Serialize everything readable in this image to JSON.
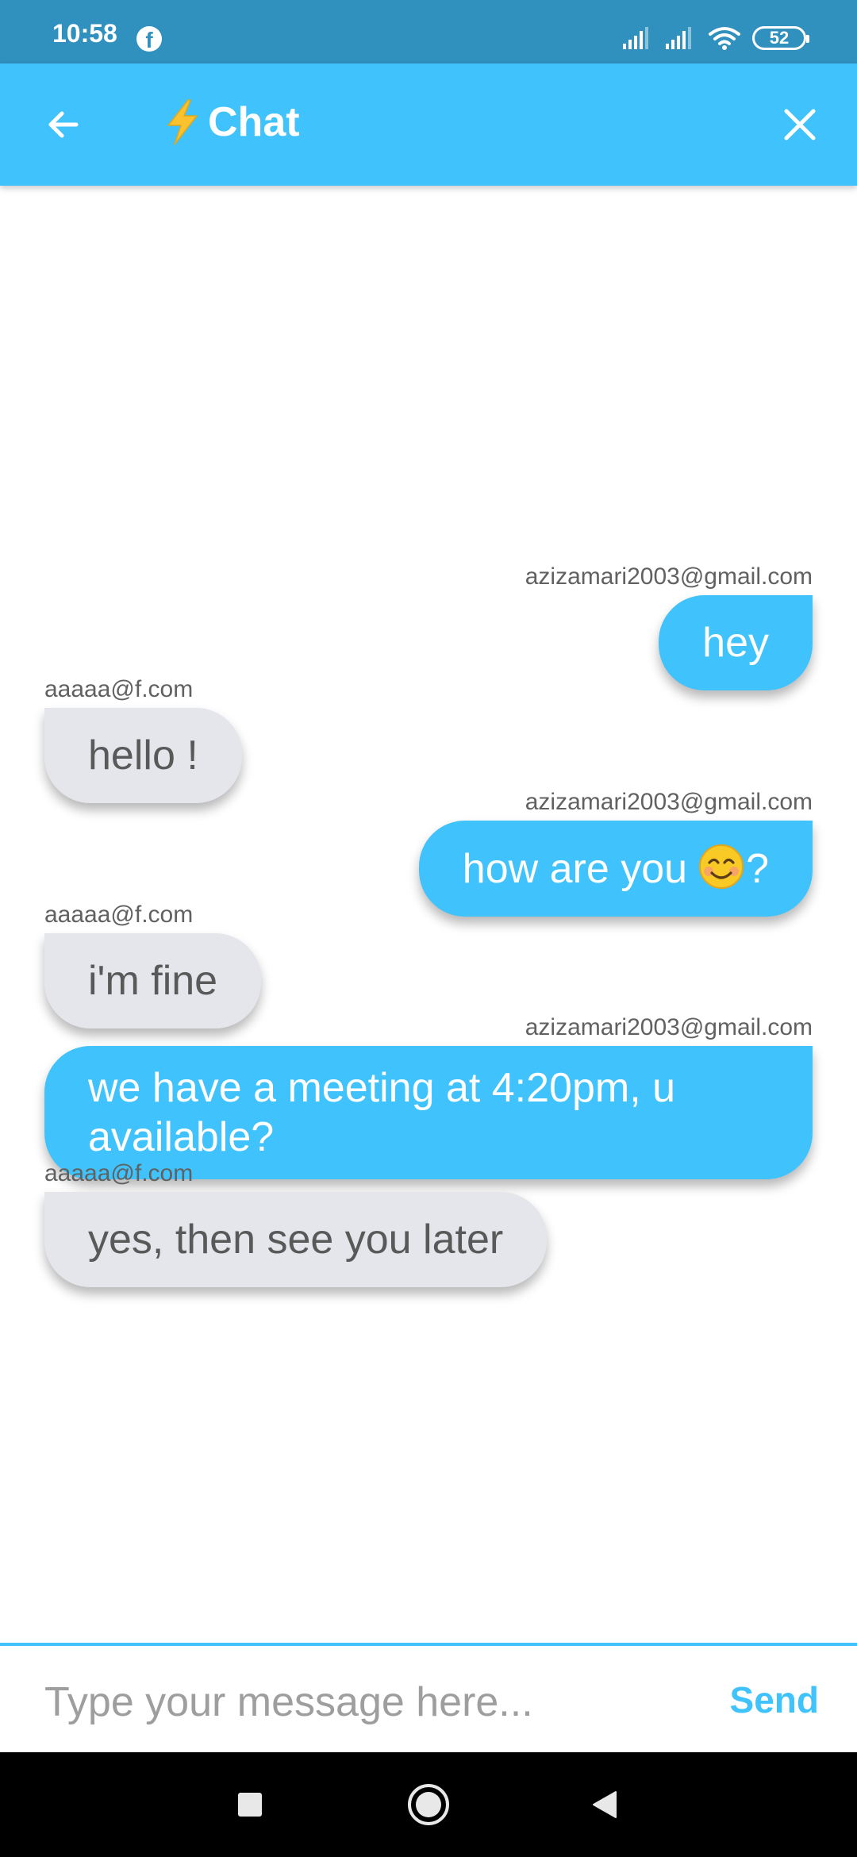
{
  "status_bar": {
    "time": "10:58",
    "notification_icons": [
      "facebook-icon"
    ],
    "system_icons": [
      "signal-sim1-icon",
      "signal-sim2-icon",
      "wifi-icon",
      "battery-icon"
    ],
    "battery": "52"
  },
  "app_bar": {
    "title_icon": "bolt-icon",
    "title": "Chat",
    "back_icon": "arrow-back-icon",
    "close_icon": "close-icon"
  },
  "messages": [
    {
      "sender": "azizamari2003@gmail.com",
      "text": "hey",
      "outgoing": true
    },
    {
      "sender": "aaaaa@f.com",
      "text": "hello !",
      "outgoing": false
    },
    {
      "sender": "azizamari2003@gmail.com",
      "text": "how are you",
      "emoji": "smiling-face-icon",
      "text_after": "?",
      "outgoing": true
    },
    {
      "sender": "aaaaa@f.com",
      "text": "i'm fine",
      "outgoing": false
    },
    {
      "sender": "azizamari2003@gmail.com",
      "text": "we have a meeting at 4:20pm, u available?",
      "outgoing": true
    },
    {
      "sender": "aaaaa@f.com",
      "text": "yes, then see you later",
      "outgoing": false
    }
  ],
  "composer": {
    "value": "",
    "placeholder": "Type your message here...",
    "send_label": "Send"
  },
  "nav_bar": {
    "icons": [
      "recents-square-icon",
      "home-circle-icon",
      "back-triangle-icon"
    ]
  },
  "colors": {
    "status_bar": "#3191be",
    "accent": "#40c3fc",
    "incoming_bubble": "#e5e6eb",
    "incoming_text": "#595959",
    "sender_text": "#616161",
    "input_underline": "#64d4e8"
  }
}
